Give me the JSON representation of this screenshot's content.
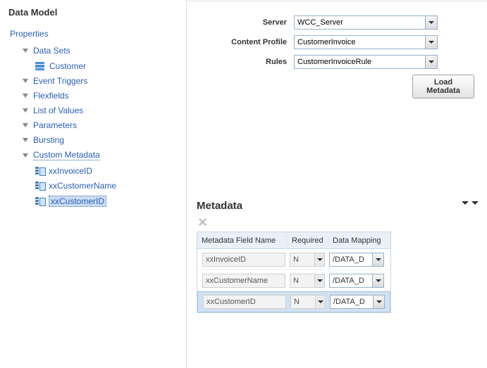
{
  "left": {
    "title": "Data Model",
    "root": "Properties",
    "nodes": {
      "dataSets": "Data Sets",
      "customer": "Customer",
      "eventTriggers": "Event Triggers",
      "flexfields": "Flexfields",
      "listOfValues": "List of Values",
      "parameters": "Parameters",
      "bursting": "Bursting",
      "customMetadata": "Custom Metadata",
      "xxInvoiceID": "xxInvoiceID",
      "xxCustomerName": "xxCustomerName",
      "xxCustomerID": "xxCustomerID"
    }
  },
  "form": {
    "serverLabel": "Server",
    "serverValue": "WCC_Server",
    "contentProfileLabel": "Content Profile",
    "contentProfileValue": "CustomerInvoice",
    "rulesLabel": "Rules",
    "rulesValue": "CustomerInvoiceRule",
    "loadBtn": "Load Metadata"
  },
  "metadata": {
    "title": "Metadata",
    "headers": {
      "name": "Metadata Field Name",
      "req": "Required",
      "map": "Data Mapping"
    },
    "rows": [
      {
        "name": "xxInvoiceID",
        "req": "N",
        "map": "/DATA_D"
      },
      {
        "name": "xxCustomerName",
        "req": "N",
        "map": "/DATA_D"
      },
      {
        "name": "xxCustomerID",
        "req": "N",
        "map": "/DATA_D"
      }
    ]
  }
}
